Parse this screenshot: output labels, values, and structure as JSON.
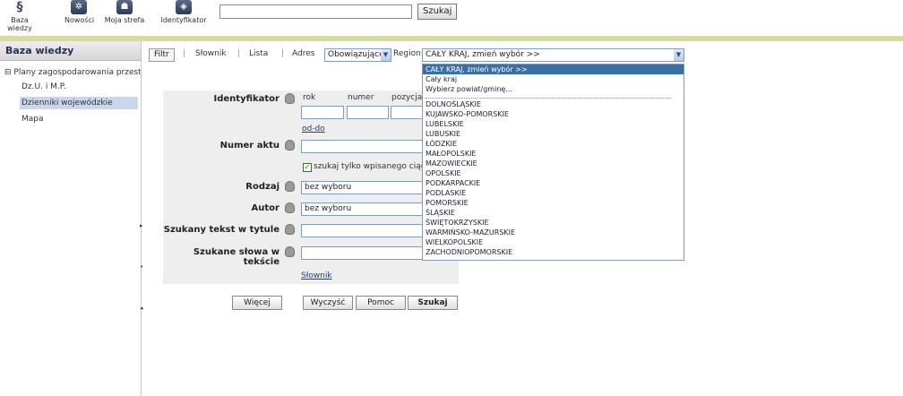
{
  "toolbar": {
    "items": [
      {
        "label": "Baza wiedzy",
        "icon": "section-sign-icon"
      },
      {
        "label": "Nowości",
        "icon": "gear-icon"
      },
      {
        "label": "Moja strefa",
        "icon": "person-icon"
      },
      {
        "label": "Identyfikator",
        "icon": "identifier-icon"
      }
    ],
    "search_value": "",
    "search_button": "Szukaj"
  },
  "sidebar": {
    "title": "Baza wiedzy",
    "root": "Plany zagospodarowania przestrze",
    "root_toggle": "⊟",
    "items": [
      "Dz.U. i M.P.",
      "Dzienniki wojewódzkie",
      "Mapa"
    ],
    "selected_index": 1
  },
  "filterbar": {
    "filter_button": "Filtr",
    "links": [
      "Słownik",
      "Lista",
      "Adres"
    ],
    "separator": "|",
    "status_select": "Obowiązujące",
    "region_label": "Region:",
    "region_select": "CAŁY KRAJ, zmień wybór >>"
  },
  "form": {
    "identyfikator": {
      "label": "Identyfikator",
      "col_rok": "rok",
      "col_numer": "numer",
      "col_pozycja": "pozycja",
      "range_link": "od-do"
    },
    "numer_aktu": {
      "label": "Numer aktu",
      "checkbox_label": "szukaj tylko wpisanego ciągu z",
      "checked": true
    },
    "rodzaj": {
      "label": "Rodzaj",
      "value": "bez wyboru"
    },
    "autor": {
      "label": "Autor",
      "value": "bez wyboru"
    },
    "tytul": {
      "label": "Szukany tekst w tytule",
      "value": ""
    },
    "tekst": {
      "label": "Szukane słowa w tekście",
      "value": ""
    },
    "dictionary_link": "Słownik"
  },
  "buttons": {
    "more": "Więcej",
    "clear": "Wyczyść",
    "help": "Pomoc",
    "search": "Szukaj"
  },
  "region_dropdown": {
    "top_options": [
      "CAŁY KRAJ, zmień wybór >>",
      "Cały kraj",
      "Wybierz powiat/gminę..."
    ],
    "highlighted_index": 0,
    "voivodeships": [
      "DOLNOŚLĄSKIE",
      "KUJAWSKO-POMORSKIE",
      "LUBELSKIE",
      "LUBUSKIE",
      "ŁÓDZKIE",
      "MAŁOPOLSKIE",
      "MAZOWIECKIE",
      "OPOLSKIE",
      "PODKARPACKIE",
      "PODLASKIE",
      "POMORSKIE",
      "ŚLĄSKIE",
      "ŚWIĘTOKRZYSKIE",
      "WARMIŃSKO-MAZURSKIE",
      "WIELKOPOLSKIE",
      "ZACHODNIOPOMORSKIE"
    ]
  }
}
